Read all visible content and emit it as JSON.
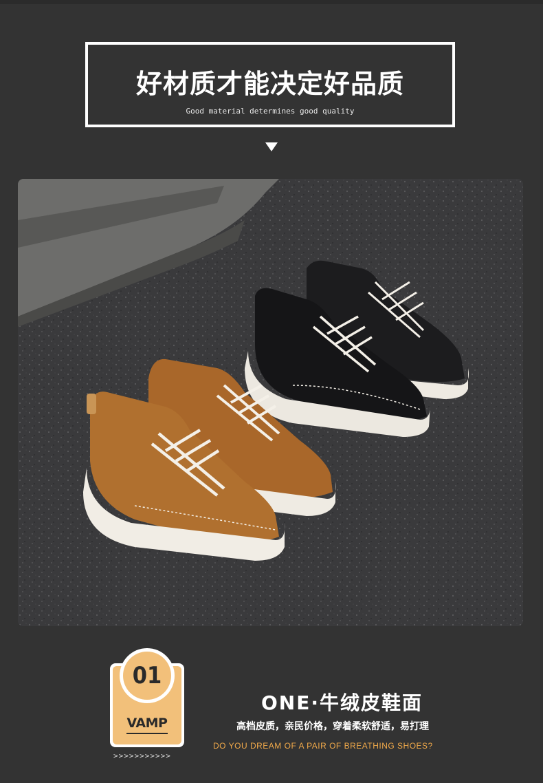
{
  "header": {
    "title": "好材质才能决定好品质",
    "subtitle": "Good material determines good quality"
  },
  "photo": {
    "description_icon": "product-photo-sneakers"
  },
  "feature": {
    "number": "01",
    "badge_label": "VAMP",
    "chevrons": ">>>>>>>>>>>",
    "title": "ONE·牛绒皮鞋面",
    "description": "高档皮质，亲民价格，穿着柔软舒适，易打理",
    "english": "DO YOU DREAM OF A PAIR OF BREATHING SHOES?"
  },
  "colors": {
    "background": "#333333",
    "accent": "#f2c07a",
    "english_text": "#f0a94a"
  }
}
